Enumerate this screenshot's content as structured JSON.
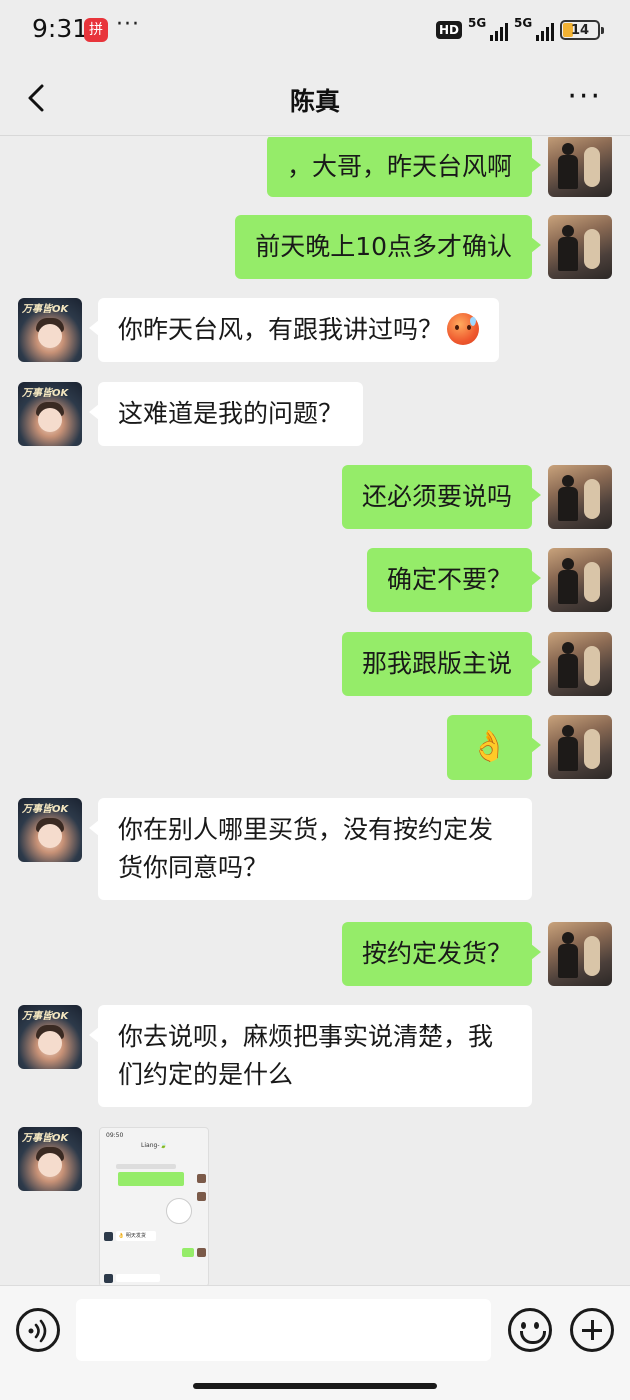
{
  "status_bar": {
    "time": "9:31",
    "app_badge": "拼",
    "more": "···",
    "hd": "HD",
    "sim1": "5G",
    "sim2": "5G",
    "battery": "14"
  },
  "nav": {
    "title": "陈真",
    "more": "···"
  },
  "messages": [
    {
      "side": "me",
      "text": "，大哥，昨天台风啊"
    },
    {
      "side": "me",
      "text": "前天晚上10点多才确认"
    },
    {
      "side": "them",
      "text": "你昨天台风，有跟我讲过吗？",
      "emoji": "sweat-face-emoji"
    },
    {
      "side": "them",
      "text": "这难道是我的问题？"
    },
    {
      "side": "me",
      "text": "还必须要说吗"
    },
    {
      "side": "me",
      "text": "确定不要？"
    },
    {
      "side": "me",
      "text": "那我跟版主说"
    },
    {
      "side": "me",
      "text": "👌"
    },
    {
      "side": "them",
      "text_line1": "你在别人哪里买货，没有按约定发",
      "text_line2": "货你同意吗？"
    },
    {
      "side": "me",
      "text": "按约定发货？"
    },
    {
      "side": "them",
      "text_line1": "你去说呗，麻烦把事实说清楚，我",
      "text_line2": "们约定的是什么"
    },
    {
      "side": "them",
      "type": "image",
      "thumb_time": "09:50",
      "thumb_title": "Liang-🍃",
      "thumb_bubble": "👌 明天发货"
    }
  ],
  "avatars": {
    "them_tag": "万事皆OK"
  },
  "input_bar": {
    "voice_icon": "voice-icon",
    "emoji_icon": "emoji-icon",
    "plus_icon": "plus-icon"
  }
}
